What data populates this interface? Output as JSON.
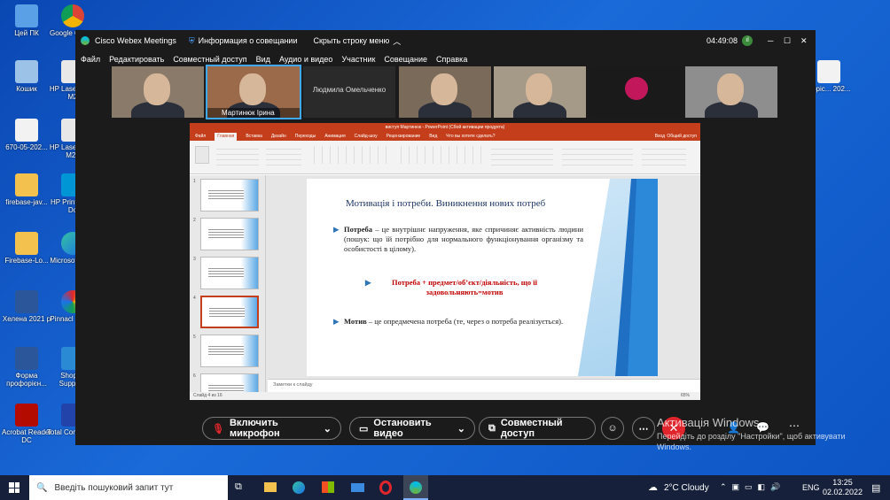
{
  "desktop_icons": [
    {
      "label": "Цей ПК",
      "icon": "computer-icon"
    },
    {
      "label": "Google Chrom",
      "icon": "chrome-icon"
    },
    {
      "label": "Кошик",
      "icon": "recycle-bin-icon"
    },
    {
      "label": "HP Laser MFP M2",
      "icon": "printer-icon"
    },
    {
      "label": "670-05-202...",
      "icon": "document-icon"
    },
    {
      "label": "HP Laser MFP M28",
      "icon": "printer-icon"
    },
    {
      "label": "firebase-jav...",
      "icon": "folder-icon"
    },
    {
      "label": "HP Print Scan Do",
      "icon": "hp-icon"
    },
    {
      "label": "Firebase-Lo...",
      "icon": "folder-icon"
    },
    {
      "label": "Microsof Edge",
      "icon": "edge-icon"
    },
    {
      "label": "Хелена 2021 р",
      "icon": "word-icon"
    },
    {
      "label": "Pinnacl Studio",
      "icon": "pinnacle-icon"
    },
    {
      "label": "Форма профорієн...",
      "icon": "word-icon"
    },
    {
      "label": "Shop fo Supplies",
      "icon": "shop-icon"
    },
    {
      "label": "Acrobat Reader DC",
      "icon": "acrobat-icon"
    },
    {
      "label": "Total Comman...",
      "icon": "total-commander-icon"
    },
    {
      "label": "Поріс... 202...",
      "icon": "document-icon"
    }
  ],
  "webex": {
    "app_title": "Cisco Webex Meetings",
    "info": "Информация о совещании",
    "hide_menu": "Скрыть строку меню",
    "timer": "04:49:08",
    "menu": [
      "Файл",
      "Редактировать",
      "Совместный доступ",
      "Вид",
      "Аудио и видео",
      "Участник",
      "Совещание",
      "Справка"
    ],
    "participants": [
      {
        "name": "",
        "bg": "#8a7a6a"
      },
      {
        "name": "Мартинюк Ірина",
        "bg": "#9b6a4a"
      },
      {
        "name": "Людмила Омельченко",
        "bg": "#2a2a2a"
      },
      {
        "name": "",
        "bg": "#7a6a5a"
      },
      {
        "name": "",
        "bg": "#a59a88"
      },
      {
        "name": "",
        "bg": "#1a1a1a"
      },
      {
        "name": "",
        "bg": "#8e8e8e"
      }
    ],
    "controls": {
      "mic": "Включить микрофон",
      "video": "Остановить видео",
      "share": "Совместный доступ"
    }
  },
  "ppt": {
    "title": "виступ Мартинюк - PowerPoint (Сбой активации продукта)",
    "tabs": [
      "Файл",
      "Главная",
      "Вставка",
      "Дизайн",
      "Переходы",
      "Анимация",
      "Слайд-шоу",
      "Рецензирование",
      "Вид",
      "Что вы хотите сделать?"
    ],
    "share": "Общий доступ",
    "login": "Вход",
    "slide": {
      "heading": "Мотивація і потреби. Виникнення нових потреб",
      "b1_bold": "Потреба",
      "b1_text": " – це внутрішнє напруження, яке спричиняє активність людини (пошук: що їй потрібно для нормального функціонування організму та особистості в цілому).",
      "b2": "Потреба + предмет/об’єкт/діяльність, що її задовольняють=мотив",
      "b3_bold": "Мотив",
      "b3_text": " – це опредмечена потреба (те, через о потреба реалізується)."
    },
    "notes": "Заметки к слайду",
    "status_left": "Слайд 4 из 16",
    "zoom": "65%",
    "thumb_numbers": [
      "1",
      "2",
      "3",
      "4",
      "5",
      "6"
    ]
  },
  "activation": {
    "title": "Активація Windows",
    "sub": "Перейдіть до розділу \"Настройки\", щоб активувати Windows."
  },
  "taskbar": {
    "search_placeholder": "Введіть пошуковий запит тут",
    "weather": "2°C Cloudy",
    "lang": "ENG",
    "time": "13:25",
    "date": "02.02.2022"
  },
  "colors": {
    "ppt_accent": "#c43e1c",
    "webex_red": "#e0262c",
    "slide_blue": "#1f6fc2",
    "bullet_blue": "#2e75b6",
    "slide_red": "#c00000"
  }
}
